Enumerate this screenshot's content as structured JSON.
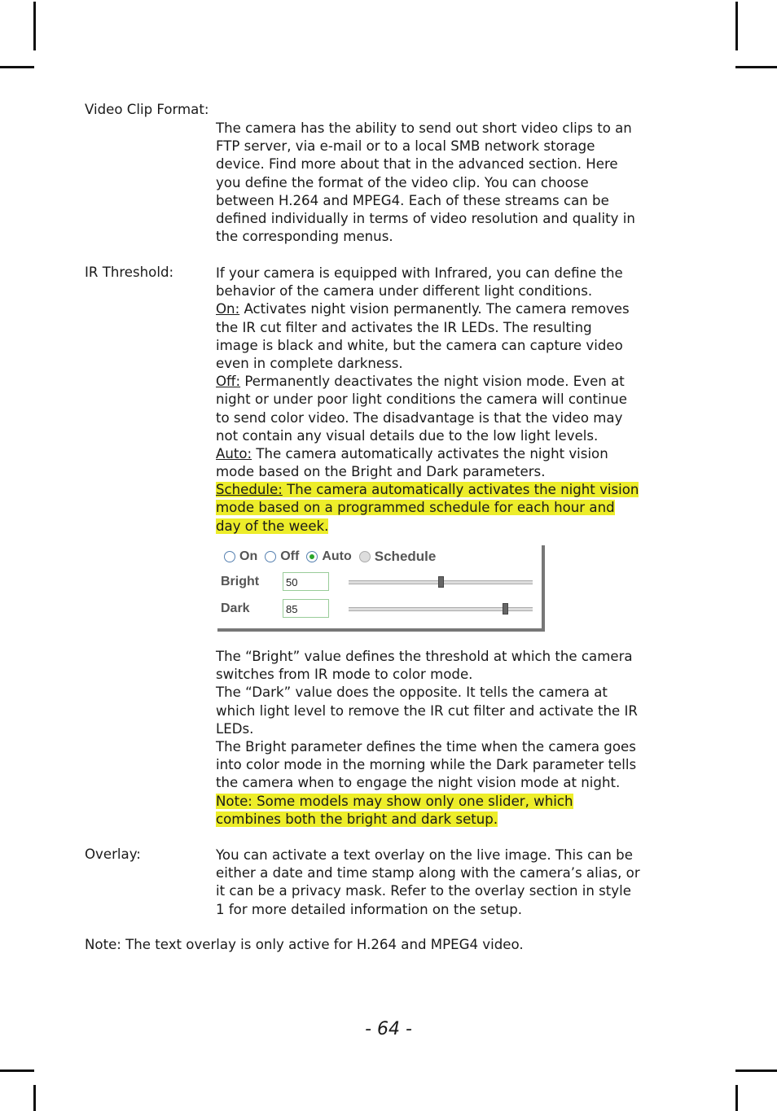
{
  "sections": {
    "video_clip": {
      "label": "Video Clip Format:",
      "lines": [
        "The camera has the ability to send out short video clips to an",
        "FTP server, via e-mail or to a local SMB network storage",
        "device. Find more about that in the advanced section. Here",
        "you define the format of the video clip. You can choose",
        "between H.264 and MPEG4. Each of these streams can be",
        "defined individually in terms of video resolution and quality in",
        "the corresponding menus."
      ]
    },
    "ir_threshold": {
      "label": "IR Threshold:",
      "intro": [
        "If your camera is equipped with Infrared, you can define the",
        "behavior of the camera under different light conditions."
      ],
      "on_label": "On:",
      "on_lines": [
        " Activates night vision permanently. The camera removes",
        "the IR cut filter and activates the IR LEDs. The resulting",
        "image is black and white, but the camera can capture video",
        "even in complete darkness."
      ],
      "off_label": "Off:",
      "off_lines": [
        " Permanently deactivates the night vision mode. Even at",
        "night or under poor light conditions the camera will continue",
        "to send color video. The disadvantage is that the video may",
        "not contain any visual details due to the low light levels."
      ],
      "auto_label": "Auto:",
      "auto_lines": [
        " The camera automatically activates the night vision",
        "mode based on the Bright and Dark parameters."
      ],
      "schedule_label": "Schedule:",
      "schedule_lines": [
        " The camera automatically activates the night vision",
        "mode based on a programmed schedule for each hour and",
        "day of the week."
      ],
      "after_lines": [
        "The “Bright” value defines the threshold at which the camera",
        "switches from IR mode to color mode.",
        "The “Dark” value does the opposite. It tells the camera at",
        "which light level to remove the IR cut filter and activate the IR",
        "LEDs.",
        "The Bright parameter defines the time when the camera goes",
        "into color mode in the morning while the Dark parameter tells",
        "the camera when to engage the night vision mode at night."
      ],
      "note_lines": [
        "Note: Some models may show only one slider, which",
        "combines both the bright and dark setup."
      ]
    },
    "overlay": {
      "label": "Overlay:",
      "lines": [
        "You can activate a text overlay on the live image. This can be",
        "either a date and time stamp along with the camera’s alias, or",
        "it can be a privacy mask. Refer to the overlay section in style",
        "1 for more detailed information on the setup."
      ]
    },
    "final_note": "Note: The text overlay is only active for H.264 and MPEG4 video."
  },
  "ir_panel": {
    "options": [
      {
        "label": "On",
        "selected": false,
        "disabled": false
      },
      {
        "label": "Off",
        "selected": false,
        "disabled": false
      },
      {
        "label": "Auto",
        "selected": true,
        "disabled": false
      },
      {
        "label": "Schedule",
        "selected": false,
        "disabled": true
      }
    ],
    "bright_label": "Bright",
    "bright_value": "50",
    "bright_slider_fraction": 0.5,
    "dark_label": "Dark",
    "dark_value": "85",
    "dark_slider_fraction": 0.85
  },
  "page_number": "- 64 -"
}
